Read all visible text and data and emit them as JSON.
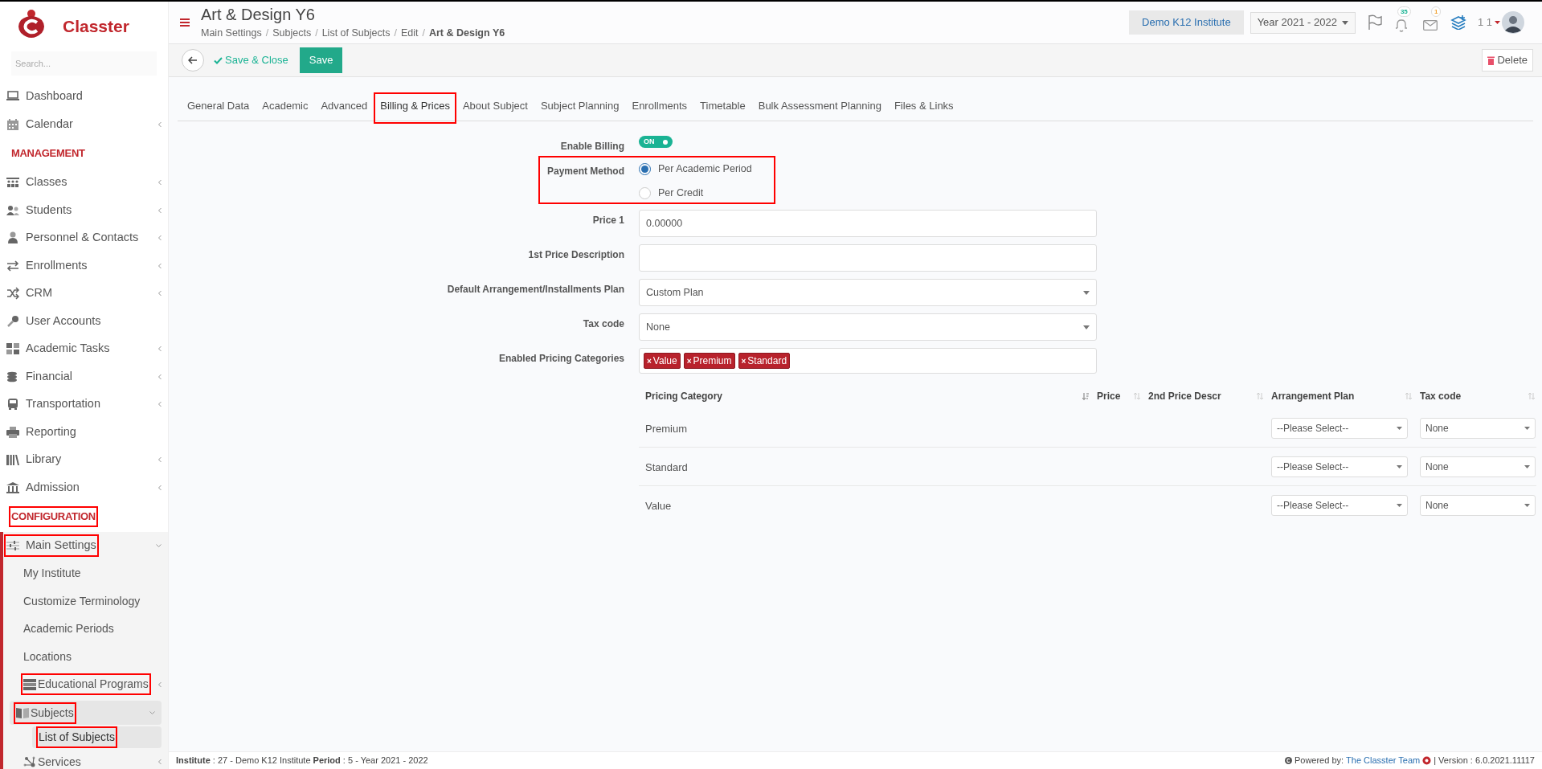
{
  "sidebar": {
    "logo_text": "Classter",
    "search_placeholder": "Search...",
    "items": [
      {
        "kind": "link",
        "label": "Dashboard",
        "expandable": false,
        "expanded": false,
        "highlighted": false
      },
      {
        "kind": "link",
        "label": "Calendar",
        "expandable": true,
        "expanded": false,
        "highlighted": false
      },
      {
        "kind": "heading",
        "label": "MANAGEMENT",
        "highlighted": false
      },
      {
        "kind": "link",
        "label": "Classes",
        "expandable": true,
        "expanded": false,
        "highlighted": false
      },
      {
        "kind": "link",
        "label": "Students",
        "expandable": true,
        "expanded": false,
        "highlighted": false
      },
      {
        "kind": "link",
        "label": "Personnel & Contacts",
        "expandable": true,
        "expanded": false,
        "highlighted": false
      },
      {
        "kind": "link",
        "label": "Enrollments",
        "expandable": true,
        "expanded": false,
        "highlighted": false
      },
      {
        "kind": "link",
        "label": "CRM",
        "expandable": true,
        "expanded": false,
        "highlighted": false
      },
      {
        "kind": "link",
        "label": "User Accounts",
        "expandable": false,
        "expanded": false,
        "highlighted": false
      },
      {
        "kind": "link",
        "label": "Academic Tasks",
        "expandable": true,
        "expanded": false,
        "highlighted": false
      },
      {
        "kind": "link",
        "label": "Financial",
        "expandable": true,
        "expanded": false,
        "highlighted": false
      },
      {
        "kind": "link",
        "label": "Transportation",
        "expandable": true,
        "expanded": false,
        "highlighted": false
      },
      {
        "kind": "link",
        "label": "Reporting",
        "expandable": false,
        "expanded": false,
        "highlighted": false
      },
      {
        "kind": "link",
        "label": "Library",
        "expandable": true,
        "expanded": false,
        "highlighted": false
      },
      {
        "kind": "link",
        "label": "Admission",
        "expandable": true,
        "expanded": false,
        "highlighted": false
      },
      {
        "kind": "heading",
        "label": "CONFIGURATION",
        "highlighted": true
      },
      {
        "kind": "link",
        "label": "Main Settings",
        "expandable": true,
        "expanded": true,
        "highlighted": true,
        "children": [
          {
            "label": "My Institute",
            "expandable": false,
            "expanded": false,
            "highlighted": false,
            "selected": false
          },
          {
            "label": "Customize Terminology",
            "expandable": false,
            "expanded": false,
            "highlighted": false,
            "selected": false
          },
          {
            "label": "Academic Periods",
            "expandable": false,
            "expanded": false,
            "highlighted": false,
            "selected": false
          },
          {
            "label": "Locations",
            "expandable": false,
            "expanded": false,
            "highlighted": false,
            "selected": false
          },
          {
            "label": "Educational Programs",
            "expandable": true,
            "expanded": false,
            "highlighted": true,
            "selected": false
          },
          {
            "label": "Subjects",
            "expandable": true,
            "expanded": true,
            "highlighted": true,
            "selected": true,
            "children": [
              {
                "label": "List of Subjects",
                "highlighted": true,
                "selected": true
              }
            ]
          },
          {
            "label": "Services",
            "expandable": true,
            "expanded": false,
            "highlighted": false,
            "selected": false
          }
        ]
      }
    ]
  },
  "header": {
    "title": "Art & Design Y6",
    "breadcrumbs": [
      {
        "label": "Main Settings",
        "separator": "/"
      },
      {
        "label": "Subjects",
        "separator": "/"
      },
      {
        "label": "List of Subjects",
        "separator": "/"
      },
      {
        "label": "Edit",
        "separator": "/"
      },
      {
        "label": "Art & Design Y6"
      }
    ],
    "institute": "Demo K12 Institute",
    "year": "Year 2021 - 2022",
    "notifications": "35",
    "messages": "1",
    "user": "1 1"
  },
  "toolbar": {
    "save_close": "Save & Close",
    "save": "Save",
    "delete": "Delete"
  },
  "tabs": [
    {
      "label": "General Data",
      "selected": false,
      "highlighted": false
    },
    {
      "label": "Academic",
      "selected": false,
      "highlighted": false
    },
    {
      "label": "Advanced",
      "selected": false,
      "highlighted": false
    },
    {
      "label": "Billing & Prices",
      "selected": true,
      "highlighted": true
    },
    {
      "label": "About Subject",
      "selected": false,
      "highlighted": false
    },
    {
      "label": "Subject Planning",
      "selected": false,
      "highlighted": false
    },
    {
      "label": "Enrollments",
      "selected": false,
      "highlighted": false
    },
    {
      "label": "Timetable",
      "selected": false,
      "highlighted": false
    },
    {
      "label": "Bulk Assessment Planning",
      "selected": false,
      "highlighted": false
    },
    {
      "label": "Files & Links",
      "selected": false,
      "highlighted": false
    }
  ],
  "form": {
    "enable_billing": {
      "label": "Enable Billing",
      "on": true,
      "text": "ON"
    },
    "payment_method": {
      "label": "Payment Method",
      "highlighted": true,
      "options": [
        {
          "label": "Per Academic Period",
          "selected": true
        },
        {
          "label": "Per Credit",
          "selected": false
        }
      ]
    },
    "fields": [
      {
        "kind": "text",
        "label": "Price 1",
        "value": "0.00000"
      },
      {
        "kind": "text",
        "label": "1st Price Description"
      },
      {
        "kind": "select",
        "label": "Default Arrangement/Installments Plan",
        "value": "Custom Plan"
      },
      {
        "kind": "select",
        "label": "Tax code",
        "value": "None"
      },
      {
        "kind": "tags",
        "label": "Enabled Pricing Categories",
        "tags": [
          {
            "label": "Value",
            "remove": "×"
          },
          {
            "label": "Premium",
            "remove": "×"
          },
          {
            "label": "Standard",
            "remove": "×"
          }
        ]
      }
    ]
  },
  "table": {
    "columns": [
      {
        "label": "Pricing Category",
        "sorted": true
      },
      {
        "label": "Price",
        "sorted": false
      },
      {
        "label": "2nd Price Descr",
        "sorted": false
      },
      {
        "label": "Arrangement Plan",
        "sorted": false
      },
      {
        "label": "Tax code",
        "sorted": false
      }
    ],
    "rows": [
      {
        "category": "Premium",
        "arrangement": "--Please Select--",
        "tax": "None"
      },
      {
        "category": "Standard",
        "arrangement": "--Please Select--",
        "tax": "None"
      },
      {
        "category": "Value",
        "arrangement": "--Please Select--",
        "tax": "None"
      }
    ]
  },
  "footer": {
    "info": "**Institute** : 27 - Demo K12 Institute **Period** : 5 - Year 2021 - 2022",
    "powered_by": "Powered by:",
    "team": "The Classter Team",
    "version": "| Version : 6.0.2021.11117"
  }
}
